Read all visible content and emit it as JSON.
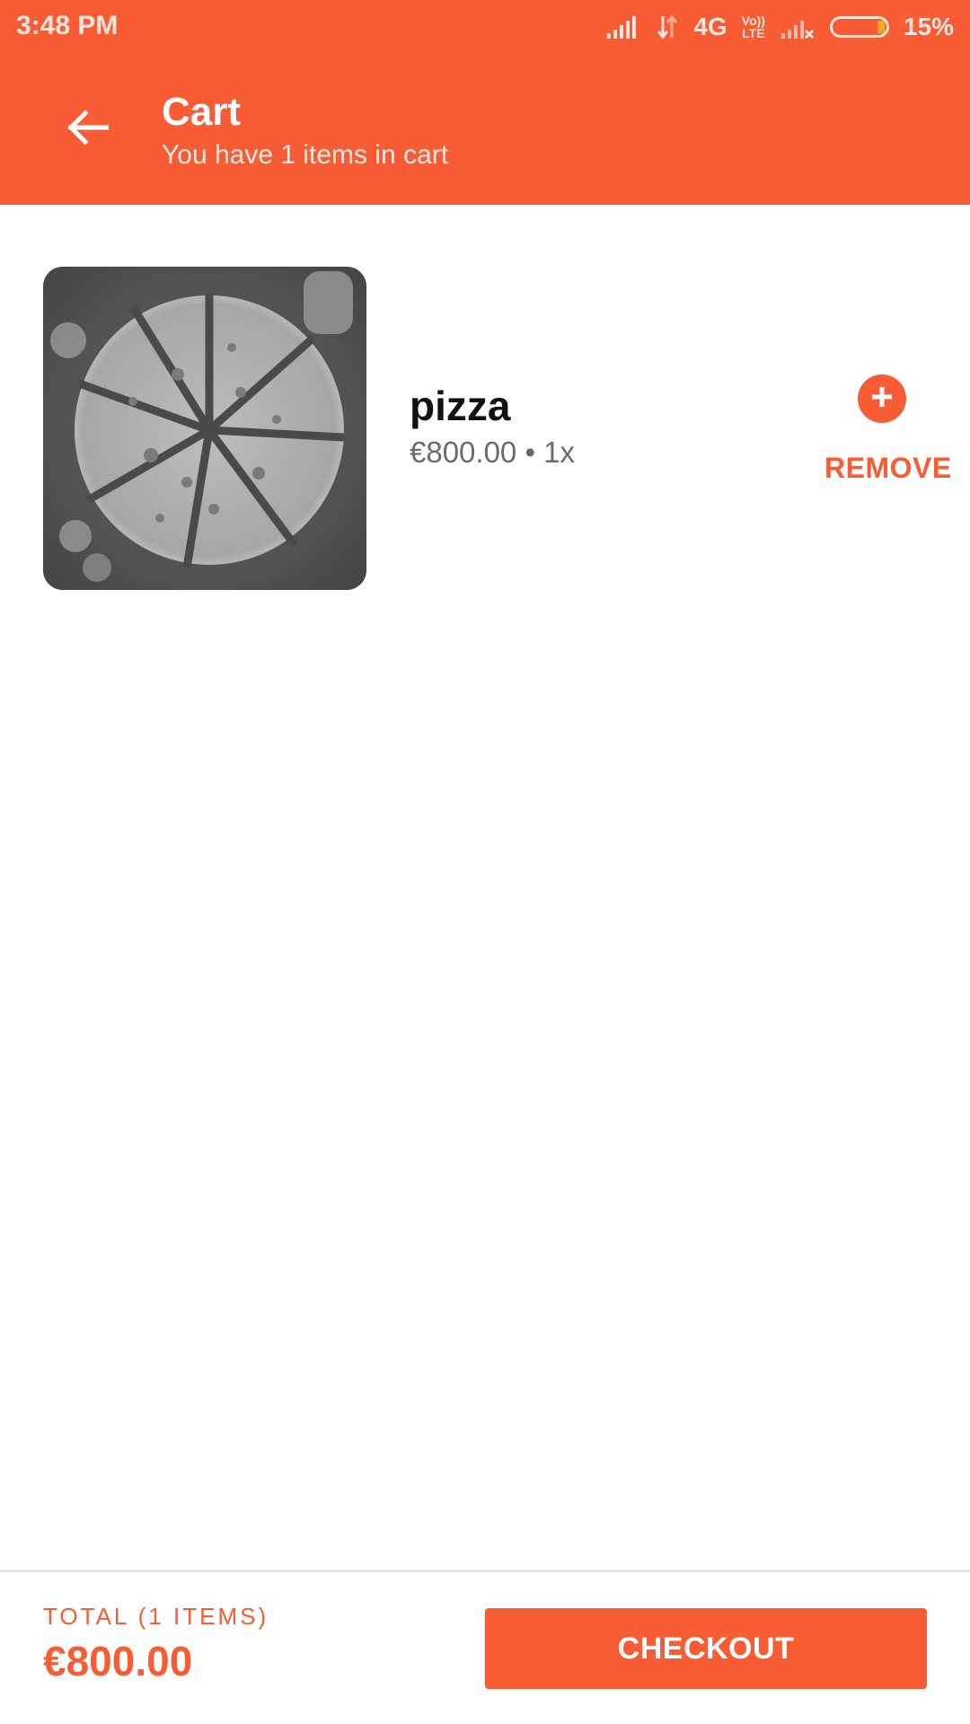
{
  "colors": {
    "accent": "#F75C34",
    "text_primary": "#111111",
    "text_secondary": "#6b6b6b",
    "battery_level": "#F9A825"
  },
  "status_bar": {
    "time": "3:48 PM",
    "network": "4G",
    "volte_top": "Vo))",
    "volte_bottom": "LTE",
    "battery_percent": "15%",
    "battery_level": 0.15,
    "icons": [
      "signal-icon",
      "data-arrows-icon",
      "volte-icon",
      "no-signal-icon",
      "battery-icon"
    ]
  },
  "app_bar": {
    "back_icon": "arrow-left-icon",
    "title": "Cart",
    "subtitle": "You have 1 items in cart"
  },
  "cart": {
    "items": [
      {
        "image": "pizza-photo",
        "name": "pizza",
        "meta": "€800.00 • 1x",
        "add_icon": "plus-circle-icon",
        "remove_label": "REMOVE"
      }
    ]
  },
  "footer": {
    "total_label": "TOTAL (1 ITEMS)",
    "total_value": "€800.00",
    "checkout_label": "CHECKOUT"
  }
}
